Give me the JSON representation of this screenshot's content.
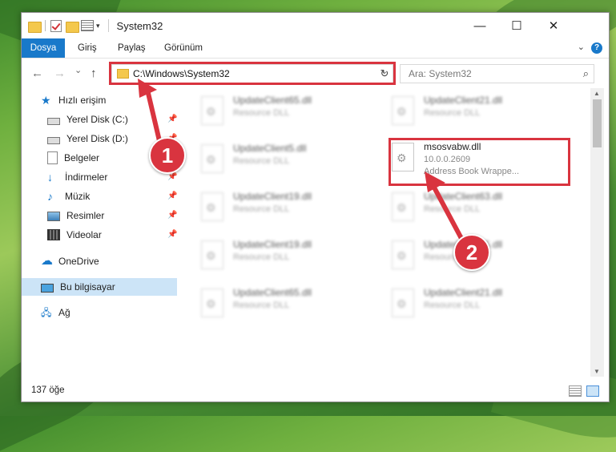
{
  "window": {
    "title": "System32",
    "minimize": "—",
    "maximize": "☐",
    "close": "✕"
  },
  "ribbon": {
    "tabs": [
      "Dosya",
      "Giriş",
      "Paylaş",
      "Görünüm"
    ],
    "help": "?"
  },
  "nav": {
    "back": "←",
    "forward": "→",
    "recent": "⌄",
    "up": "↑",
    "address": "C:\\Windows\\System32",
    "refresh": "↻",
    "search_placeholder": "Ara: System32"
  },
  "sidebar": {
    "items": [
      {
        "label": "Hızlı erişim",
        "icon": "star-icon"
      },
      {
        "label": "Yerel Disk (C:)",
        "icon": "drive-icon",
        "pinned": true
      },
      {
        "label": "Yerel Disk (D:)",
        "icon": "drive-icon",
        "pinned": true
      },
      {
        "label": "Belgeler",
        "icon": "documents-icon",
        "pinned": true
      },
      {
        "label": "İndirmeler",
        "icon": "download-icon",
        "pinned": true
      },
      {
        "label": "Müzik",
        "icon": "music-icon",
        "pinned": true
      },
      {
        "label": "Resimler",
        "icon": "pictures-icon",
        "pinned": true
      },
      {
        "label": "Videolar",
        "icon": "video-icon",
        "pinned": true
      },
      {
        "label": "OneDrive",
        "icon": "cloud-icon"
      },
      {
        "label": "Bu bilgisayar",
        "icon": "computer-icon",
        "selected": true
      },
      {
        "label": "Ağ",
        "icon": "network-icon"
      }
    ]
  },
  "files": {
    "left_column": [
      {
        "name": "UpdateClient65.dll",
        "type": "Resource DLL"
      },
      {
        "name": "UpdateClient5.dll",
        "type": "Resource DLL"
      },
      {
        "name": "UpdateClient19.dll",
        "type": "Resource DLL"
      },
      {
        "name": "UpdateClient19.dll",
        "type": "Resource DLL"
      },
      {
        "name": "UpdateClient65.dll",
        "type": "Resource DLL"
      }
    ],
    "right_column": [
      {
        "name": "UpdateClient21.dll",
        "type": "Resource DLL"
      },
      {
        "name": "msosvabw.dll",
        "version": "10.0.0.2609",
        "description": "Address Book Wrappe...",
        "highlighted": true
      },
      {
        "name": "UpdateClient63.dll",
        "type": "Resource DLL"
      },
      {
        "name": "UpdateClient65.dll",
        "type": "Resource DLL"
      },
      {
        "name": "UpdateClient21.dll",
        "type": "Resource DLL"
      }
    ]
  },
  "status": {
    "count": "137 öğe"
  },
  "annotations": {
    "badge_1": "1",
    "badge_2": "2",
    "accent": "#d9343f"
  },
  "colors": {
    "file_tab": "#1979ca",
    "selected_nav": "#cce4f7"
  }
}
